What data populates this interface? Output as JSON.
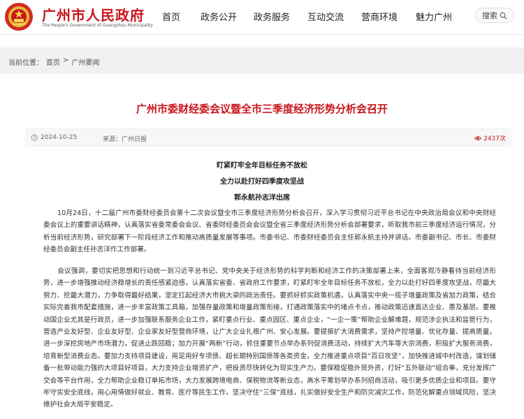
{
  "header": {
    "site_title": "广州市人民政府",
    "site_subtitle": "The People's Government of Guangzhou Municipality",
    "nav": [
      "首页",
      "政务公开",
      "政务服务",
      "互动交流",
      "营商环境",
      "魅力广州"
    ],
    "search_label": "搜索"
  },
  "breadcrumb": {
    "prefix": "当前位置：",
    "items": [
      "首页",
      "广州要闻"
    ],
    "separator": ">"
  },
  "article": {
    "title": "广州市委财经委会议暨全市三季度经济形势分析会召开",
    "date": "2024-10-25",
    "source": "来源：广州日报",
    "views": "2437次",
    "subtitles": [
      "盯紧盯牢全年目标任务不放松",
      "全力以赴打好四季度攻坚战",
      "郭永航孙志洋出席"
    ],
    "paragraphs": [
      "10月24日，十二届广州市委财经委员会第十二次会议暨全市三季度经济形势分析会召开，深入学习贯彻习近平总书记在中央政治局会议和中央财经委会议上的重要讲话精神，认真落实省委常委会会议、省委财经委员会会议暨全省三季度经济形势分析会部署要求，听取我市前三季度经济运行情况，分析当前经济形势，研究部署下一阶段经济工作和推动高质量发展等事项。市委书记、市委财经委员会主任郭永航主持并讲话。市委副书记、市长、市委财经委员会副主任孙志洋作工作部署。",
      "会议强调，要切实把思想和行动统一到习近平总书记、党中央关于经济形势的科学判断和经济工作的决策部署上来，全面客观冷静看待当前经济形势，进一步增强推动经济稳增长的责任感紧迫感，认真落实省委、省政府工作要求，盯紧盯牢全年目标任务不放松，全力以赴打好四季度攻坚战，尽最大努力、挖最大潜力，力争取得最好结果，坚定扛起经济大市挑大梁的政治责任。要抓好抓实政策机遇，认真落实中央一揽子增量政策及省加力政策，结合实际完善我市配套措施，进一步丰富政策工具箱，加强存量政策和增量政策衔接，打通政策落实中的堵点卡点，推动政策迅速直达企业、惠及基层。要推动国企业尤其是行政员，进一步加强联系服务企业工作，紧盯重点行业、重点园区、重点企业，“一企一策”帮助企业解难题，规范涉企执法和监管行为，营造产业友好型、企业友好型、企业家友好型营商环境，让广大企业扎根广州、安心发展。要提振扩大消费需求，坚持产控增量、优化存量、提高质量，进一步深挖房地产市场潜力，促进止跌回稳；加力开展“两新”行动，抓住重要节点举办系列促消费活动，持续扩大汽车等大宗消费，积极扩大服务消费，培育新型消费业态。要加力支持项目建设，用足用好专项债、超长期特别国债等各类资金，全力推进重点项目“百日攻坚”，加快推进城中村改造，谋划储备一批带动能力强的大项目好项目，大力支持企业增资扩产，把投资尽快转化为现实生产力。要保稳促稳外贸外资，打好“五外联动”组合拳，充分发挥广交会等平台作用，全力帮助企业稳订单拓市场，大力发展跨境电商、保税物流等新业态，高水平筹划举办系列招商活动，吸引更多优质企业和项目。要守牢守实安全底线，用心用情做好就业、教育、医疗等民生工作，坚决守住“三保”底线，扎实做好安全生产和防灾减灾工作，防范化解重点领域风险，坚决维护社会大局平安稳定。"
    ]
  },
  "colors": {
    "brand_red": "#c8161d",
    "breadcrumb_bg": "#f1f1f1"
  },
  "icons": [
    "emblem-logo",
    "search-icon",
    "clock-icon",
    "eye-icon"
  ]
}
